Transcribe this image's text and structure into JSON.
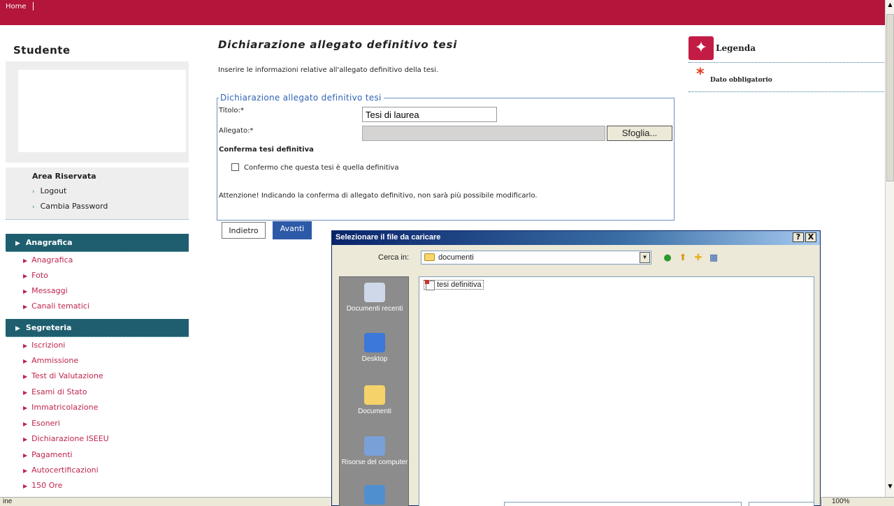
{
  "topbar": {
    "home": "Home"
  },
  "sidebar": {
    "title": "Studente",
    "area": {
      "title": "Area Riservata",
      "links": [
        "Logout",
        "Cambia Password"
      ]
    },
    "sections": [
      {
        "label": "Anagrafica",
        "items": [
          "Anagrafica",
          "Foto",
          "Messaggi",
          "Canali tematici"
        ]
      },
      {
        "label": "Segreteria",
        "items": [
          "Iscrizioni",
          "Ammissione",
          "Test di Valutazione",
          "Esami di Stato",
          "Immatricolazione",
          "Esoneri",
          "Dichiarazione ISEEU",
          "Pagamenti",
          "Autocertificazioni",
          "150 Ore"
        ]
      }
    ]
  },
  "main": {
    "title": "Dichiarazione allegato definitivo tesi",
    "intro": "Inserire le informazioni relative all'allegato definitivo della tesi.",
    "form": {
      "legend": "Dichiarazione allegato definitivo tesi",
      "title_label": "Titolo:*",
      "title_value": "Tesi di laurea",
      "attachment_label": "Allegato:*",
      "browse_button": "Sfoglia...",
      "confirm_heading": "Conferma tesi definitiva",
      "confirm_checkbox": "Confermo che questa tesi è quella definitiva",
      "warning": "Attenzione! Indicando la conferma di allegato definitivo, non sarà più possibile modificarlo."
    },
    "back_button": "Indietro",
    "next_button": "Avanti"
  },
  "legend": {
    "title": "Legenda",
    "required_label": "Dato obbligatorio",
    "star": "*"
  },
  "dialog": {
    "title": "Selezionare il file da caricare",
    "help_button": "?",
    "close_button": "X",
    "look_in_label": "Cerca in:",
    "look_in_value": "documenti",
    "places": [
      "Documenti recenti",
      "Desktop",
      "Documenti",
      "Risorse del computer"
    ],
    "files": [
      "tesi definitiva"
    ]
  },
  "statusbar": {
    "text": "ine",
    "zoom": "100%"
  },
  "colors": {
    "brand": "#b3163a",
    "nav": "#1e5e6e",
    "link": "#c0244d",
    "legend": "#3163b5",
    "button": "#2d5aa8"
  }
}
